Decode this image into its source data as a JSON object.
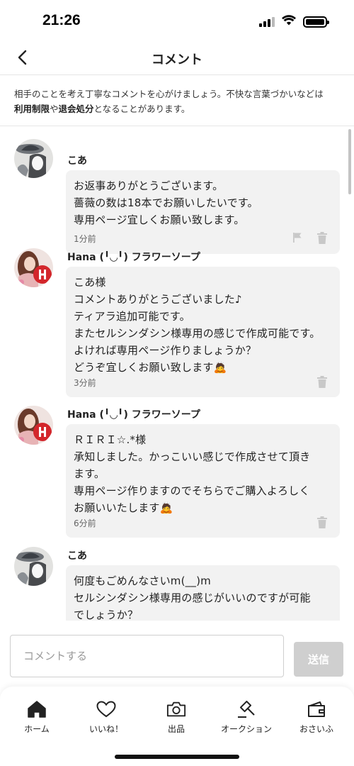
{
  "status": {
    "time": "21:26"
  },
  "nav": {
    "title": "コメント"
  },
  "notice": {
    "text_1": "相手のことを考え丁寧なコメントを心がけましょう。不快な言葉づかいなどは",
    "bold_1": "利用制限",
    "text_2": "や",
    "bold_2": "退会処分",
    "text_3": "となることがあります。"
  },
  "comments": [
    {
      "name": "こあ",
      "text": "お返事ありがとうございます。\n薔薇の数は18本でお願いしたいです。\n専用ページ宜しくお願い致します。",
      "time": "1分前",
      "avatar": "hat-portrait"
    },
    {
      "name": "Hana (╹◡╹) フラワーソープ",
      "text": "こあ様\nコメントありがとうございました♪\nティアラ追加可能です。\nまたセルシンダシン様専用の感じで作成可能です。\nよければ専用ページ作りましょうか？\nどうぞ宜しくお願い致します🙇",
      "time": "3分前",
      "avatar": "flower-photo"
    },
    {
      "name": "Hana (╹◡╹) フラワーソープ",
      "text": "ＲＩＲＩ☆.*様\n承知しました。かっこいい感じで作成させて頂き\nます。\n専用ページ作りますのでそちらでご購入よろしく\nお願いいたします🙇",
      "time": "6分前",
      "avatar": "flower-photo"
    },
    {
      "name": "こあ",
      "text": "何度もごめんなさいm(__)m\nセルシンダシン様専用の感じがいいのですが可能\nでしょうか？",
      "time": "",
      "avatar": "hat-portrait"
    }
  ],
  "input": {
    "placeholder": "コメントする",
    "send_label": "送信"
  },
  "tabs": [
    {
      "label": "ホーム",
      "icon": "home-icon"
    },
    {
      "label": "いいね！",
      "icon": "heart-icon"
    },
    {
      "label": "出品",
      "icon": "camera-icon"
    },
    {
      "label": "オークション",
      "icon": "gavel-icon"
    },
    {
      "label": "おさいふ",
      "icon": "wallet-icon"
    }
  ]
}
